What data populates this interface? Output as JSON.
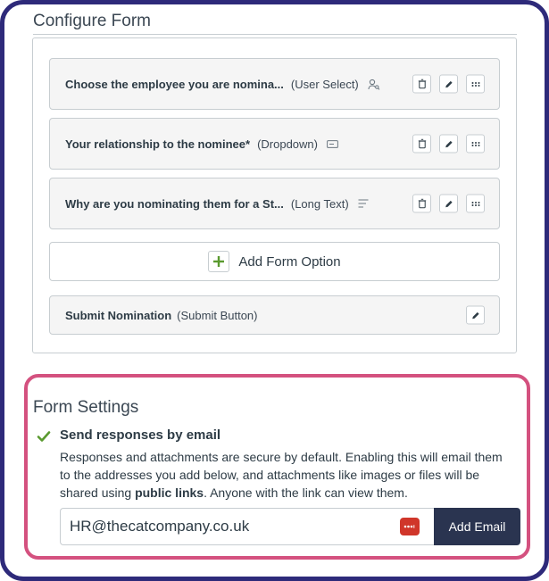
{
  "configure": {
    "title": "Configure Form",
    "fields": [
      {
        "label": "Choose the employee you are nomina...",
        "type": "(User Select)",
        "icon": "user-search-icon"
      },
      {
        "label": "Your relationship to the nominee*",
        "type": "(Dropdown)",
        "icon": "dropdown-icon"
      },
      {
        "label": "Why are you nominating them for a St...",
        "type": "(Long Text)",
        "icon": "long-text-icon"
      }
    ],
    "add_option_label": "Add Form Option",
    "submit": {
      "label": "Submit Nomination",
      "type": "(Submit Button)"
    }
  },
  "settings": {
    "title": "Form Settings",
    "send_label": "Send responses by email",
    "send_checked": true,
    "description_pre": "Responses and attachments are secure by default. Enabling this will email them to the addresses you add below, and attachments like images or files will be shared using",
    "description_link": "public links",
    "description_post": ". Anyone with the link can view them.",
    "email_value": "HR@thecatcompany.co.uk",
    "add_email_label": "Add Email"
  },
  "colors": {
    "frame": "#2e2a7a",
    "highlight": "#d4517f",
    "accent_green": "#5a9a2f",
    "button_dark": "#2a3450",
    "password_badge": "#d0362a"
  }
}
